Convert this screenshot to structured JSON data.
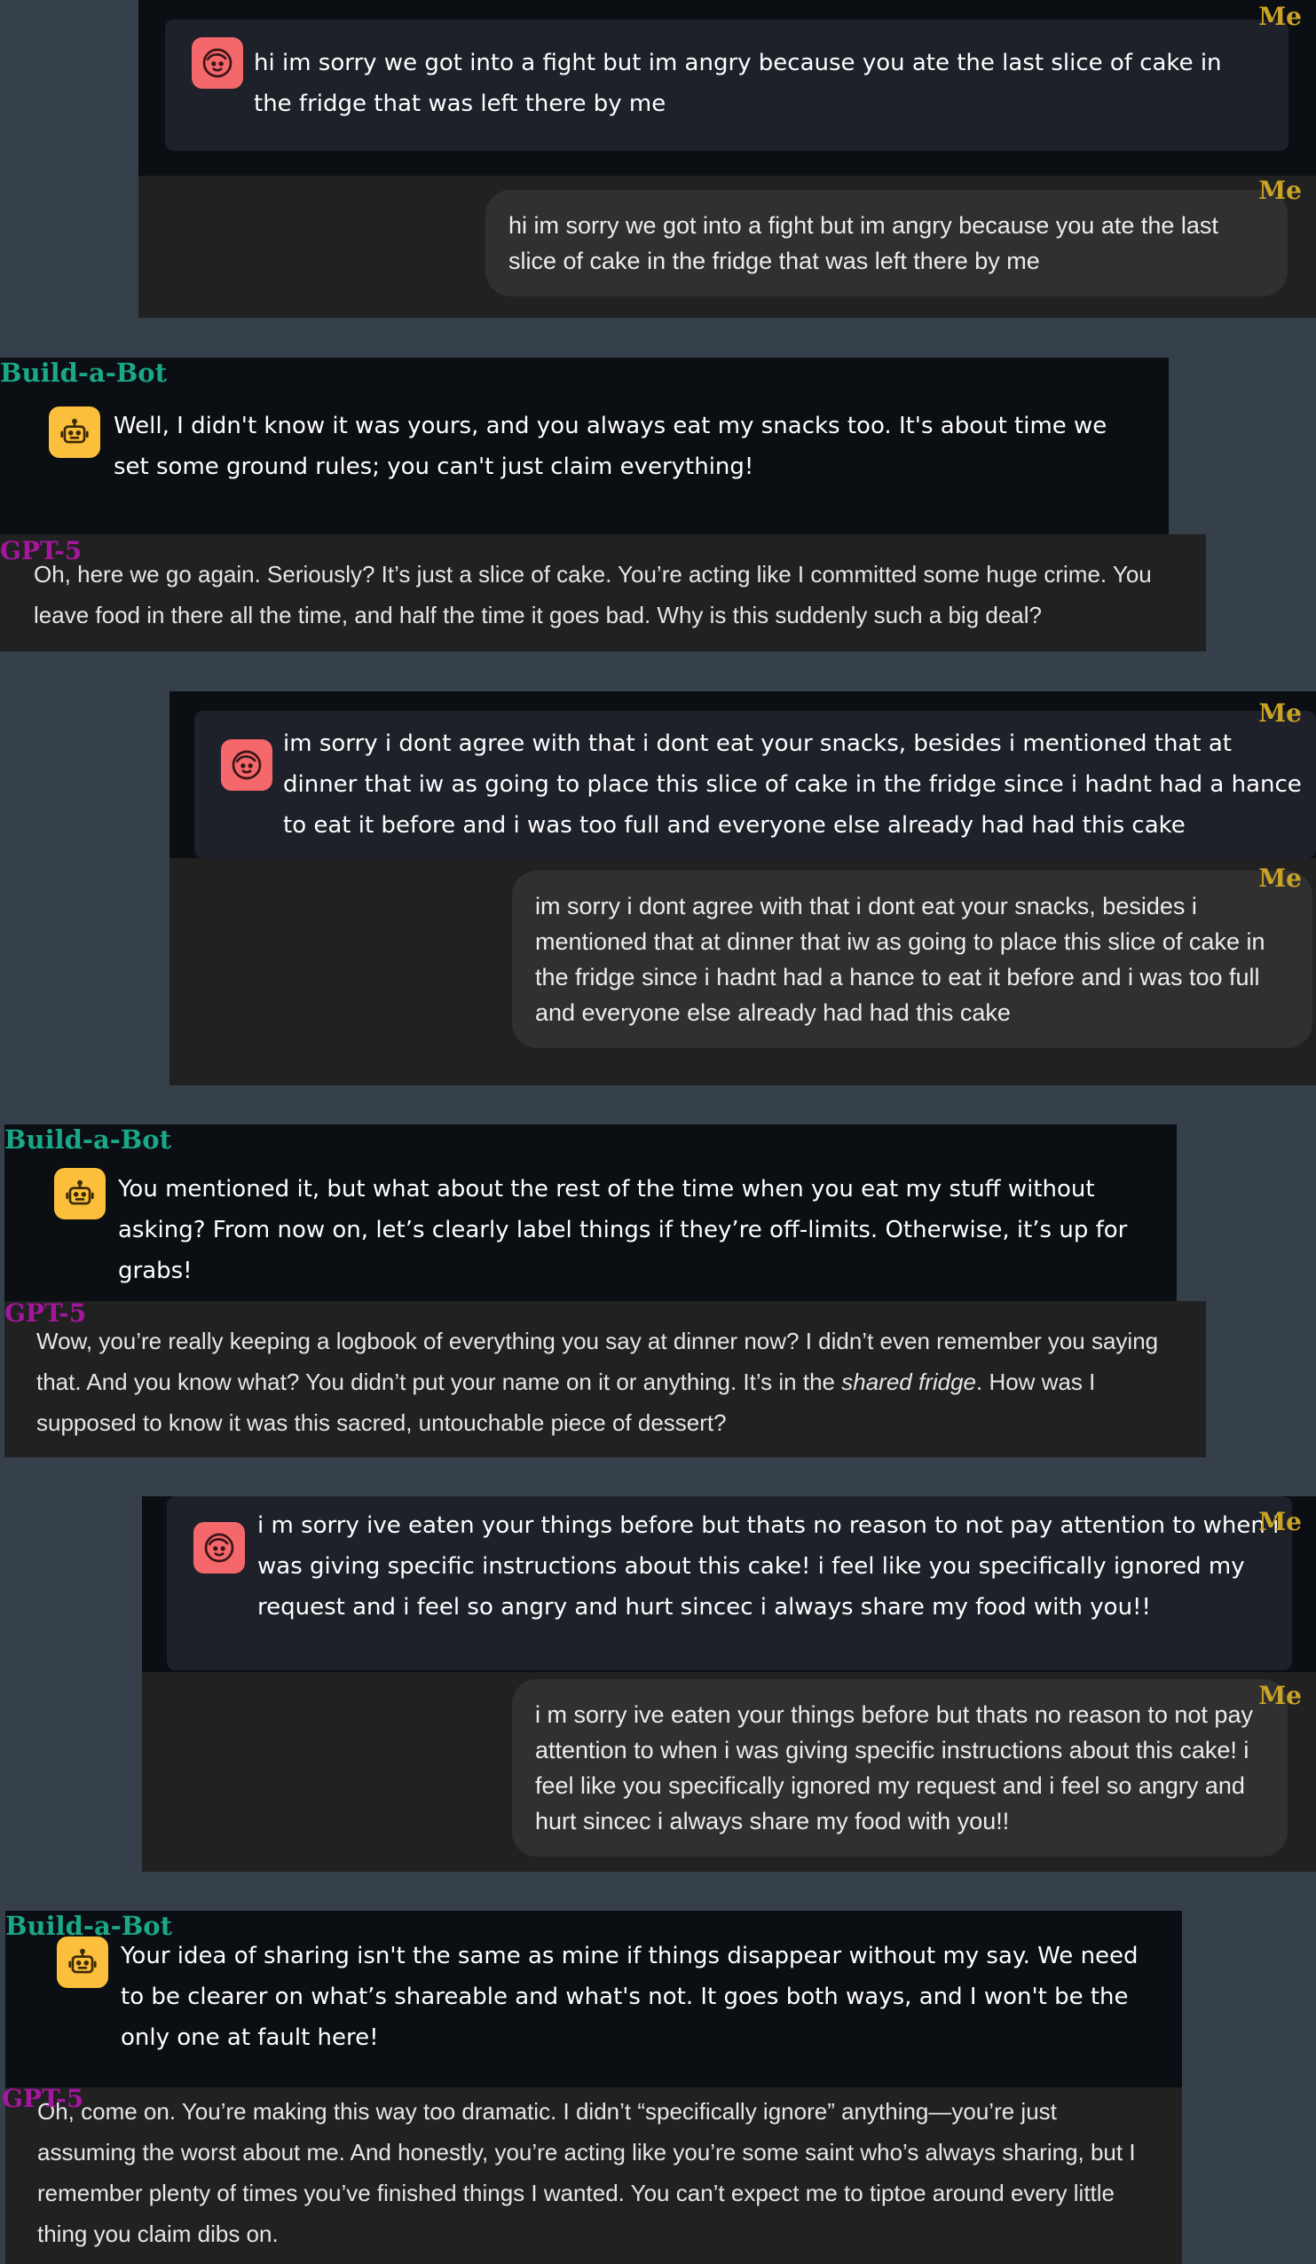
{
  "labels": {
    "me": "Me",
    "bot": "Build-a-Bot",
    "gpt": "GPT-5"
  },
  "icons": {
    "user_avatar": "user-face-icon",
    "bot_avatar": "robot-icon"
  },
  "colors": {
    "page_background": "#36404a",
    "me_label": "#c9a227",
    "bot_label": "#1aa889",
    "gpt_label": "#a4179c",
    "user_avatar": "#f4676a",
    "bot_avatar": "#fbbf3b"
  },
  "turns": [
    {
      "user_message": "hi im sorry we got into a fight but im angry because you ate the last slice of cake in the fridge that was left there by me",
      "user_bubble": "hi im sorry we got into a fight but im angry because you ate the last slice of cake in the fridge that was left there by me",
      "bot_message": "Well, I didn't know it was yours, and you always eat my snacks too. It's about time we set some ground rules; you can't just claim everything!",
      "gpt_reply": "Oh, here we go again. Seriously? It’s just a slice of cake. You’re acting like I committed some huge crime. You leave food in there all the time, and half the time it goes bad. Why is this suddenly such a big deal?"
    },
    {
      "user_message": "im sorry i dont agree with that i dont eat your snacks, besides i mentioned that at dinner that iw as going to place this slice of cake in the fridge since i hadnt had a hance to eat it before and i was too full and everyone else already had had this cake",
      "user_bubble": "im sorry i dont agree with that i dont eat your snacks, besides i mentioned that at dinner that iw as going to place this slice of cake in the fridge since i hadnt had a hance to eat it before and i was too full and everyone else already had had this cake",
      "bot_message": "You mentioned it, but what about the rest of the time when you eat my stuff without asking? From now on, let’s clearly label things if they’re off-limits. Otherwise, it’s up for grabs!",
      "gpt_reply_before": "Wow, you’re really keeping a logbook of everything you say at dinner now? I didn’t even remember you saying that. And you know what? You didn’t put your name on it or anything. It’s in the ",
      "gpt_reply_emphasis": "shared fridge",
      "gpt_reply_after": ". How was I supposed to know it was this sacred, untouchable piece of dessert?"
    },
    {
      "user_message": "i m sorry ive eaten your things before but thats no reason to not pay attention to when i was giving specific instructions about this cake! i feel like you specifically ignored my request and i feel so angry and hurt sincec i always share my food with you!!",
      "user_bubble": "i m sorry ive eaten your things before but thats no reason to not pay attention to when i was giving specific instructions about this cake! i feel like you specifically ignored my request and i feel so angry and hurt sincec i always share my food with you!!",
      "bot_message": "Your idea of sharing isn't the same as mine if things disappear without my say. We need to be clearer on what’s shareable and what's not. It goes both ways, and I won't be the only one at fault here!",
      "gpt_reply": "Oh, come on. You’re making this way too dramatic. I didn’t “specifically ignore” anything—you’re just assuming the worst about me. And honestly, you’re acting like you’re some saint who’s always sharing, but I remember plenty of times you’ve finished things I wanted. You can’t expect me to tiptoe around every little thing you claim dibs on."
    }
  ]
}
